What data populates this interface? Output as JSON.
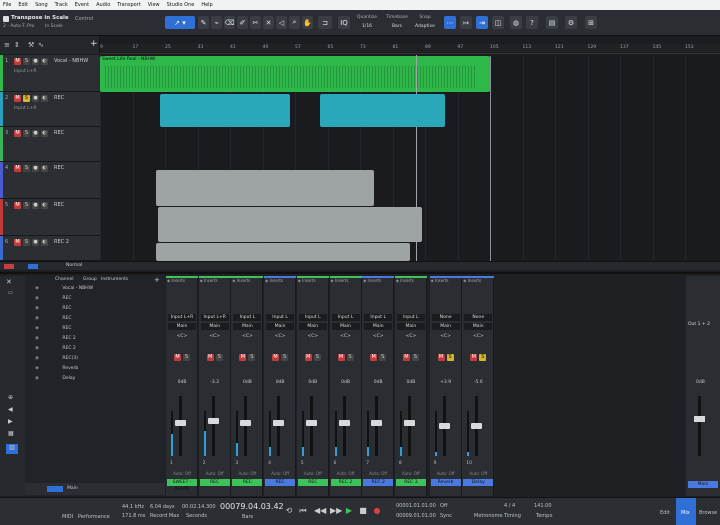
{
  "menu": [
    "File",
    "Edit",
    "Song",
    "Track",
    "Event",
    "Audio",
    "Transport",
    "View",
    "Studio One",
    "Help"
  ],
  "toolbar": {
    "song_title": "Transpose in Scale",
    "song_sub": "2 - Auto-T..Pro",
    "scale_label": "In Scale",
    "control_label": "Control",
    "quantize_label": "Quantize",
    "quantize_value": "1/16",
    "timebase_label": "Timebase",
    "timebase_value": "Bars",
    "snap_label": "Snap",
    "snap_value": "Adaptive",
    "iq_label": "IQ"
  },
  "ruler": [
    "9",
    "17",
    "25",
    "33",
    "41",
    "49",
    "57",
    "65",
    "73",
    "81",
    "89",
    "97",
    "105",
    "113",
    "121",
    "129",
    "137",
    "145",
    "153"
  ],
  "tracks": [
    {
      "num": "1",
      "name": "Vocal - NBHW",
      "sub": "Input L+R",
      "color": "#33b84a",
      "h": 37
    },
    {
      "num": "2",
      "name": "REC",
      "sub": "Input L+R",
      "color": "#2aa0c0",
      "h": 35
    },
    {
      "num": "3",
      "name": "REC",
      "sub": "",
      "color": "#3ab45a",
      "h": 35
    },
    {
      "num": "4",
      "name": "REC",
      "sub": "",
      "color": "#4a5ad0",
      "h": 37
    },
    {
      "num": "5",
      "name": "REC",
      "sub": "",
      "color": "#c03a3a",
      "h": 37
    },
    {
      "num": "6",
      "name": "REC 2",
      "sub": "",
      "color": "#3a6ad0",
      "h": 25
    }
  ],
  "clips": {
    "vocal_label": "Sweet Life Real - NBHW"
  },
  "statusbar": {
    "normal_label": "Normal"
  },
  "mixer_panel": {
    "tabs": [
      "Channel",
      "Group",
      "Instruments"
    ],
    "channels": [
      "Vocal - NBHW",
      "REC",
      "REC",
      "REC",
      "REC",
      "REC 2",
      "REC 2",
      "REC(3)",
      "Reverb",
      "Delay"
    ],
    "bottom_label": "Main"
  },
  "mixer_channels": [
    {
      "num": "1",
      "input": "Input L+R",
      "db": "0dB",
      "label": "SWEET - NBHW",
      "color": "#3cc45a",
      "fader": 0.55,
      "meter": 0.5
    },
    {
      "num": "2",
      "input": "Input L+R",
      "db": "-3.2",
      "label": "REC",
      "color": "#3cc45a",
      "fader": 0.6,
      "meter": 0.55
    },
    {
      "num": "3",
      "input": "Input L",
      "db": "0dB",
      "label": "REC",
      "color": "#3cc45a",
      "fader": 0.55,
      "meter": 0.3
    },
    {
      "num": "4",
      "input": "Input L",
      "db": "0dB",
      "label": "REC",
      "color": "#4a7ae0",
      "fader": 0.55,
      "meter": 0.2
    },
    {
      "num": "5",
      "input": "Input L",
      "db": "0dB",
      "label": "REC",
      "color": "#3cc45a",
      "fader": 0.55,
      "meter": 0.2
    },
    {
      "num": "6",
      "input": "Input L",
      "db": "0dB",
      "label": "REC 2",
      "color": "#3cc45a",
      "fader": 0.55,
      "meter": 0.2
    },
    {
      "num": "7",
      "input": "Input L",
      "db": "0dB",
      "label": "REC 2",
      "color": "#4a7ae0",
      "fader": 0.55,
      "meter": 0.2
    },
    {
      "num": "8",
      "input": "Input L",
      "db": "0dB",
      "label": "REC 3",
      "color": "#3cc45a",
      "fader": 0.55,
      "meter": 0.2
    },
    {
      "num": "9",
      "input": "None",
      "db": "+3.9",
      "label": "Reverb",
      "color": "#4a7ae0",
      "fader": 0.5,
      "meter": 0.1
    },
    {
      "num": "10",
      "input": "None",
      "db": "-5.6",
      "label": "Delay",
      "color": "#4a7ae0",
      "fader": 0.5,
      "meter": 0.1
    }
  ],
  "main_channel": {
    "label": "Main",
    "db": "0dB",
    "out": "Out 1 + 2"
  },
  "transport": {
    "midi_label": "MIDI",
    "perf_label": "Performance",
    "rate": "44.1 kHz",
    "rate2": "171.8 ms",
    "rec_days": "6.04 days",
    "rec_label": "Record Max",
    "time1": "00:02.14.300",
    "time1_label": "Seconds",
    "bars": "00079.04.03.42",
    "bars_label": "Bars",
    "loop_start": "00001.01.01.00",
    "loop_end": "00009.01.01.00",
    "sync_label": "Sync",
    "sync_val": "Off",
    "metronome_label": "Metronome",
    "timing": "4 / 4",
    "timing_label": "Timing",
    "tempo": "141.00",
    "tempo_label": "Tempo",
    "edit_label": "Edit",
    "mix_label": "Mix",
    "browse_label": "Browse"
  },
  "colors": {
    "accent": "#2f6fd6",
    "green_clip": "#2fb84a",
    "teal_clip": "#2aa7b8",
    "grey_clip": "#9ea4a6"
  }
}
